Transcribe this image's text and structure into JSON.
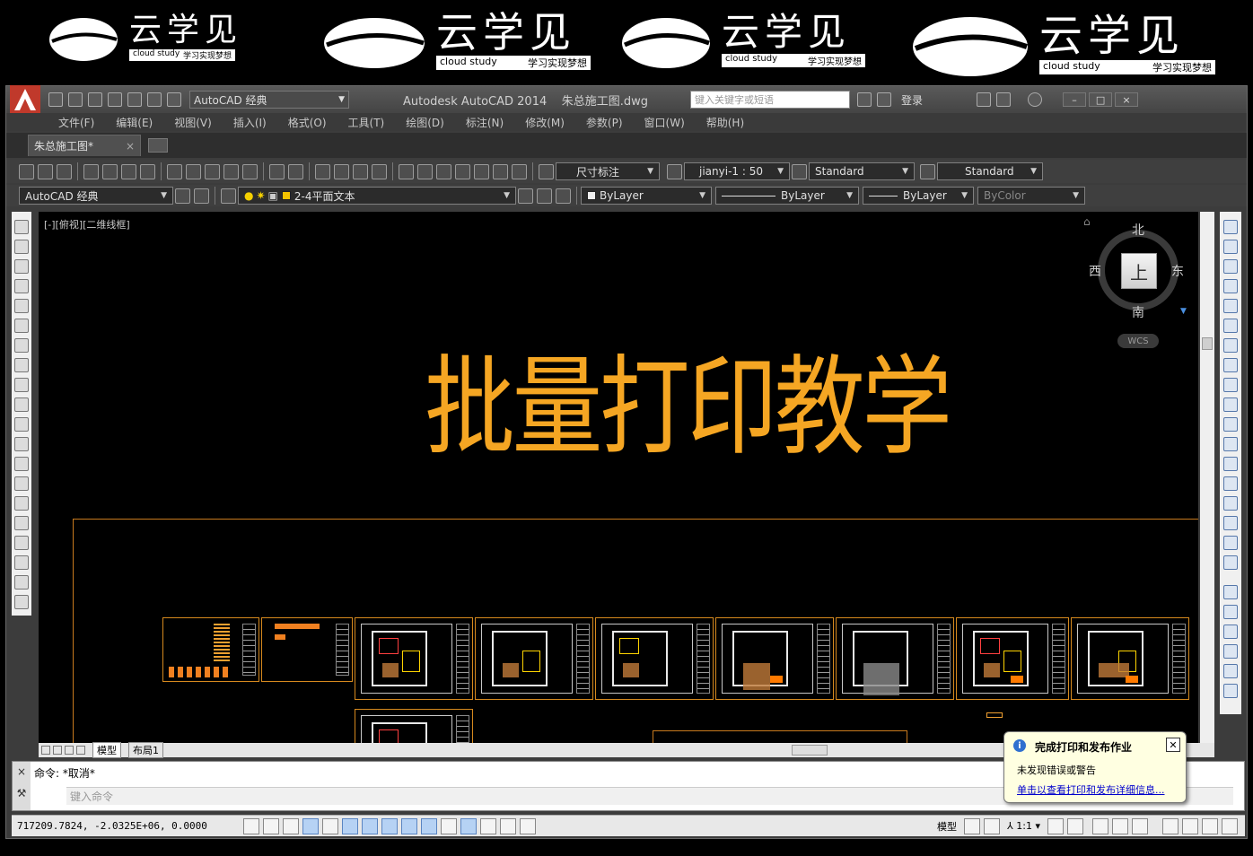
{
  "watermark": {
    "brand_cn": "云学见",
    "brand_en": "cloud study",
    "slogan": "学习实现梦想"
  },
  "titlebar": {
    "workspace": "AutoCAD 经典",
    "app_title": "Autodesk AutoCAD 2014",
    "file_name": "朱总施工图.dwg",
    "search_placeholder": "键入关键字或短语",
    "login": "登录"
  },
  "menu": [
    "文件(F)",
    "编辑(E)",
    "视图(V)",
    "插入(I)",
    "格式(O)",
    "工具(T)",
    "绘图(D)",
    "标注(N)",
    "修改(M)",
    "参数(P)",
    "窗口(W)",
    "帮助(H)"
  ],
  "doc_tab": {
    "label": "朱总施工图*"
  },
  "toolbar1": {
    "dim_style": "尺寸标注",
    "scale": "jianyi-1 : 50",
    "text_style": "Standard",
    "table_style": "Standard"
  },
  "toolbar2": {
    "workspace": "AutoCAD 经典",
    "layer": "2-4平面文本",
    "color": "ByLayer",
    "linetype": "ByLayer",
    "lineweight": "ByLayer",
    "plotstyle": "ByColor"
  },
  "canvas": {
    "viewport_label": "[-][俯视][二维线框]",
    "title": "批量打印教学"
  },
  "viewcube": {
    "face": "上",
    "north": "北",
    "south": "南",
    "east": "东",
    "west": "西",
    "wcs": "WCS"
  },
  "layout_tabs": [
    "模型",
    "布局1"
  ],
  "command": {
    "history": "命令: *取消*",
    "prompt": "键入命令"
  },
  "status": {
    "coords": "717209.7824,  -2.0325E+06,  0.0000",
    "model": "模型",
    "scale": "1:1"
  },
  "balloon": {
    "title": "完成打印和发布作业",
    "message": "未发现错误或警告",
    "link": "单击以查看打印和发布详细信息..."
  },
  "colors": {
    "accent_text": "#f5a623",
    "frame": "#d6891e",
    "canvas": "#000000"
  }
}
